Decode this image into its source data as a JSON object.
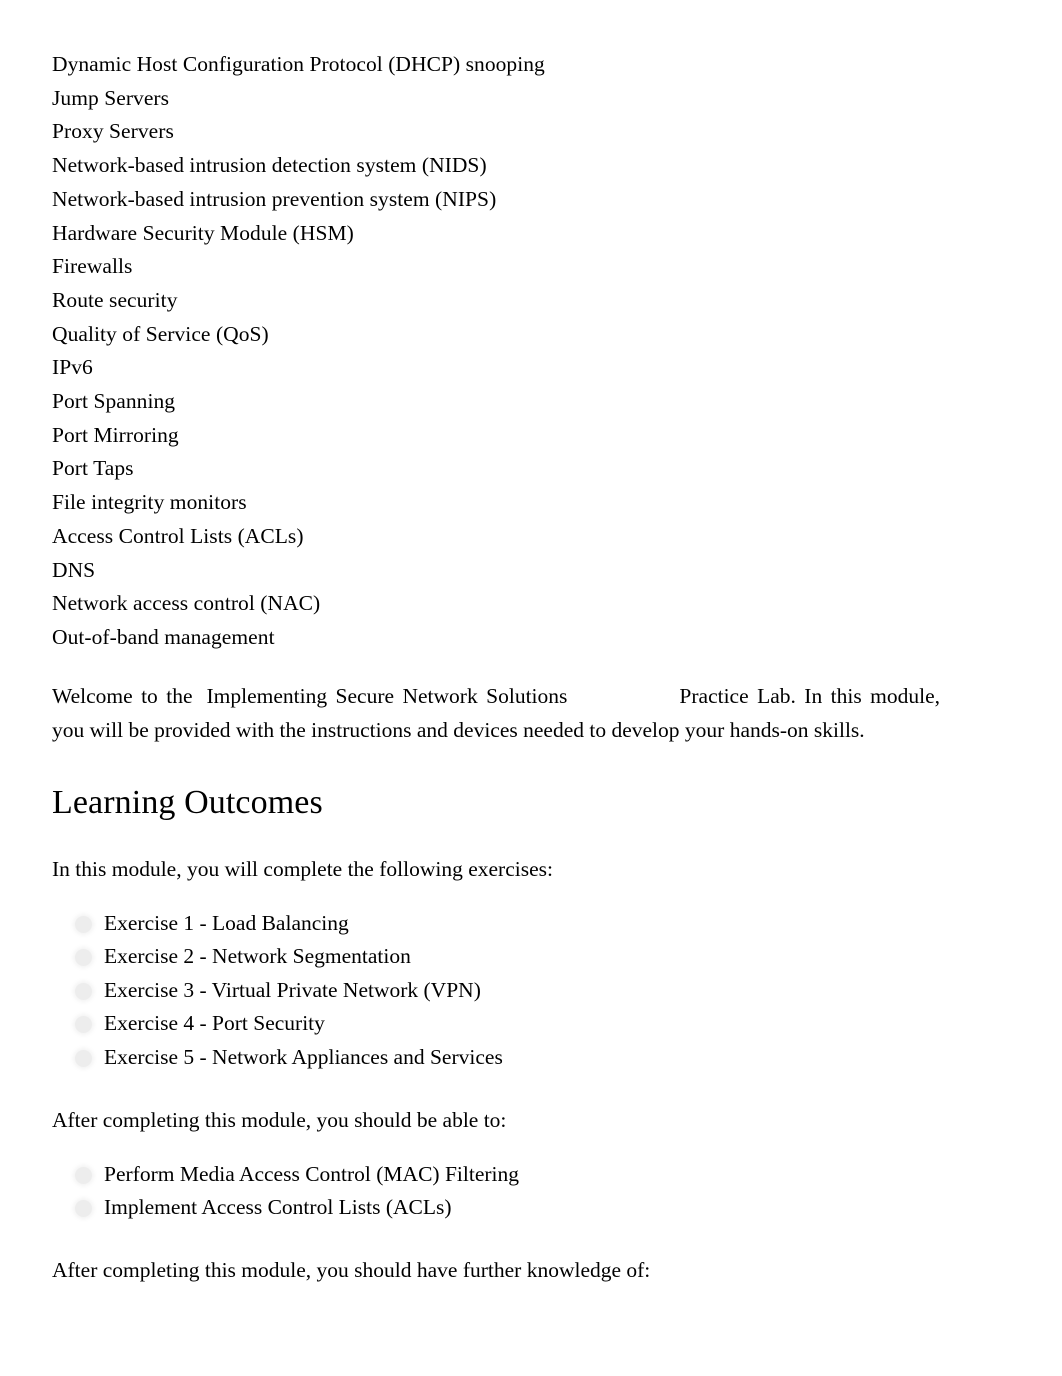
{
  "document": {
    "topics": [
      "Dynamic Host Configuration Protocol (DHCP) snooping",
      "Jump Servers",
      "Proxy Servers",
      "Network-based intrusion detection system (NIDS)",
      "Network-based intrusion prevention system (NIPS)",
      "Hardware Security Module (HSM)",
      "Firewalls",
      "Route security",
      "Quality of Service (QoS)",
      "IPv6",
      "Port Spanning",
      "Port Mirroring",
      "Port Taps",
      "File integrity monitors",
      "Access Control Lists (ACLs)",
      "DNS",
      "Network access control (NAC)",
      "Out-of-band management"
    ],
    "welcome": {
      "lead": "Welcome to the",
      "lab_title": "Implementing Secure Network Solutions",
      "tail": "Practice Lab. In this module, you will be provided with the instructions and devices needed to develop your hands-on skills."
    },
    "learning_outcomes": {
      "heading": "Learning Outcomes",
      "exercises_intro": "In this module, you will complete the following exercises:",
      "exercises": [
        "Exercise 1 - Load Balancing",
        "Exercise 2 - Network Segmentation",
        "Exercise 3 - Virtual Private Network (VPN)",
        "Exercise 4 - Port Security",
        "Exercise 5 - Network Appliances and Services"
      ],
      "able_to_intro": "After completing this module, you should be able to:",
      "able_to": [
        "Perform Media Access Control (MAC) Filtering",
        "Implement Access Control Lists (ACLs)"
      ],
      "knowledge_intro": "After completing this module, you should have further knowledge of:"
    }
  }
}
